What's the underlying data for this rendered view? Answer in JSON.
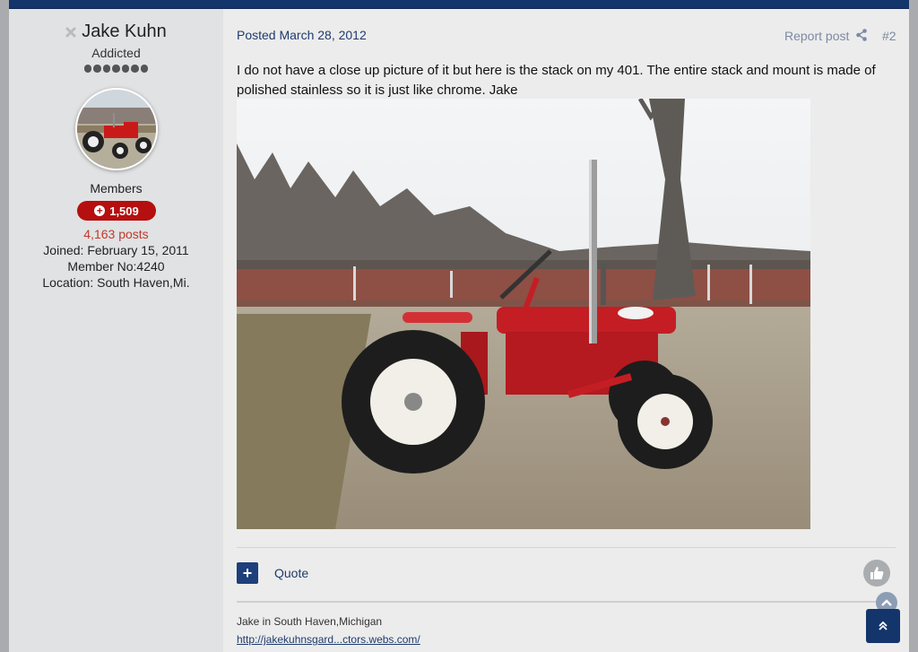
{
  "author": {
    "name": "Jake Kuhn",
    "rank": "Addicted",
    "rank_pips": 7,
    "group": "Members",
    "reputation": "1,509",
    "post_count": "4,163 posts",
    "joined": "Joined: February 15, 2011",
    "member_no": "Member No:4240",
    "location": "Location: South Haven,Mi."
  },
  "post": {
    "posted": "Posted March 28, 2012",
    "report": "Report post",
    "number": "#2",
    "body": "I do not have a close up picture of it but here is the stack on my 401. The entire stack and mount is made of polished stainless so it is just like chrome. Jake"
  },
  "actions": {
    "quote": "Quote"
  },
  "signature": {
    "text": "Jake in South Haven,Michigan",
    "link": "http://jakekuhnsgard...ctors.webs.com/"
  },
  "colors": {
    "header_navy": "#13356b",
    "reputation_red": "#b50f0f",
    "link_blue": "#1f3b6e"
  }
}
